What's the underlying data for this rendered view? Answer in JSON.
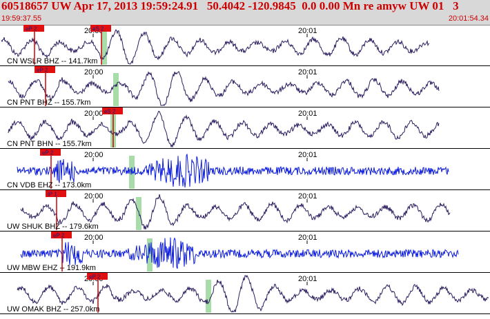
{
  "header": {
    "title": "60518657 UW Apr 17, 2013 19:59:24.91   50.4042 -120.9845  0.0 0.00 Mn re amyw UW 01   3",
    "start_time": "19:59:37.55",
    "end_time": "20:01:54.34",
    "bg_color": "#d8d8d8",
    "text_color": "#cc0000"
  },
  "colors": {
    "trace_dark": "#2a1a5e",
    "trace_blue": "#0a1adc",
    "pick_marker": "#e01010",
    "pick_line": "#cc0000",
    "window_marker": "#a8dca8",
    "grid": "#000000"
  },
  "traces": [
    {
      "label": "CN WSLR BHZ -- 141.7km",
      "color": "dark",
      "pick_label": "eP 2",
      "pick2_label": "eS 2",
      "minute_ticks": [
        "20:00",
        "20:01"
      ]
    },
    {
      "label": "CN PNT BHZ -- 155.7km",
      "color": "dark",
      "pick_label": "eP 2",
      "pick2_label": "",
      "minute_ticks": [
        "20:00",
        "20:01"
      ]
    },
    {
      "label": "CN PNT BHN -- 155.7km",
      "color": "dark",
      "pick_label": "",
      "pick2_label": "eS 2",
      "minute_ticks": [
        "20:00",
        "20:01"
      ]
    },
    {
      "label": "CN VDB EHZ -- 173.0km",
      "color": "blue",
      "pick_label": "eP 2",
      "pick2_label": "",
      "minute_ticks": [
        "20:00",
        "20:01"
      ]
    },
    {
      "label": "UW SHUK BHZ -- 179.6km",
      "color": "dark",
      "pick_label": "iP 1",
      "pick2_label": "",
      "minute_ticks": [
        "20:00",
        "20:01"
      ]
    },
    {
      "label": "UW MBW EHZ -- 191.9km",
      "color": "blue",
      "pick_label": "eP 2",
      "pick2_label": "",
      "minute_ticks": [
        "20:00",
        "20:01"
      ]
    },
    {
      "label": "UW OMAK BHZ -- 257.0km",
      "color": "dark",
      "pick_label": "eP 2",
      "pick2_label": "",
      "minute_ticks": [
        "20:00",
        "20:01"
      ]
    }
  ]
}
